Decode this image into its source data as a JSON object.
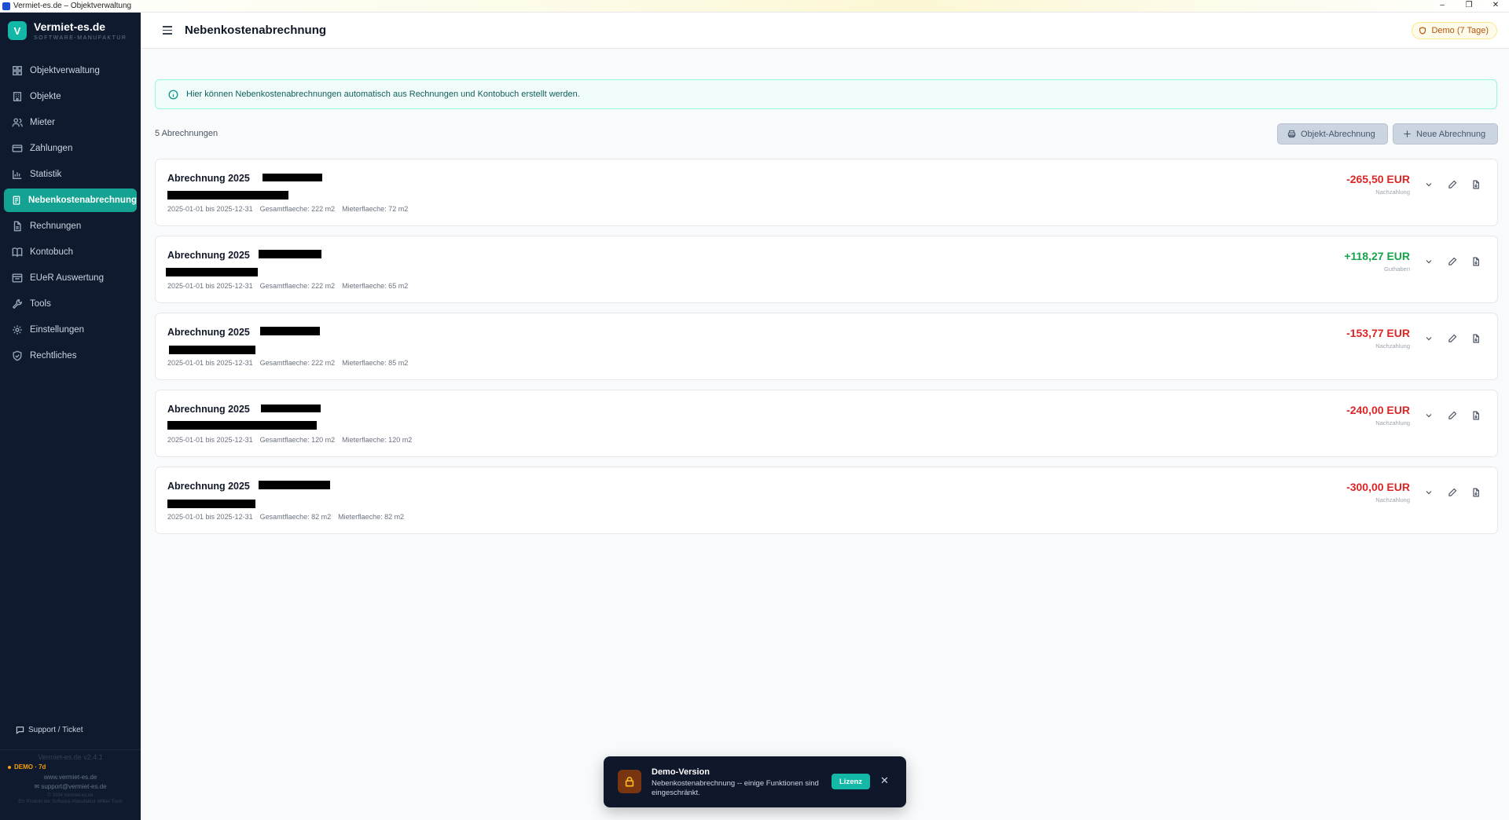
{
  "window": {
    "title": "Vermiet-es.de – Objektverwaltung",
    "controls": [
      "–",
      "❐",
      "✕"
    ]
  },
  "brand": {
    "logo_letter": "V",
    "name": "Vermiet-es.de",
    "tagline": "SOFTWARE-MANUFAKTUR"
  },
  "sidebar": {
    "items": [
      {
        "label": "Objektverwaltung",
        "icon": "grid-icon"
      },
      {
        "label": "Objekte",
        "icon": "building-icon"
      },
      {
        "label": "Mieter",
        "icon": "users-icon"
      },
      {
        "label": "Zahlungen",
        "icon": "credit-card-icon"
      },
      {
        "label": "Statistik",
        "icon": "bar-chart-icon"
      },
      {
        "label": "Nebenkostenabrechnung",
        "icon": "receipt-icon",
        "active": true
      },
      {
        "label": "Rechnungen",
        "icon": "file-icon"
      },
      {
        "label": "Kontobuch",
        "icon": "book-icon"
      },
      {
        "label": "EUeR Auswertung",
        "icon": "report-icon"
      },
      {
        "label": "Tools",
        "icon": "wrench-icon"
      },
      {
        "label": "Einstellungen",
        "icon": "gear-icon"
      },
      {
        "label": "Rechtliches",
        "icon": "shield-icon"
      }
    ],
    "support_label": "Support / Ticket",
    "version": "Vermiet-es.de v2.4.1",
    "demo_tag": "DEMO · 7d",
    "website": "www.vermiet-es.de",
    "email": "support@vermiet-es.de",
    "copyright": "© 2024 Vermiet-es.de",
    "legal": "Ein Produkt der Software-Manufaktur Wilker Tools"
  },
  "header": {
    "title": "Nebenkostenabrechnung",
    "demo_badge": "Demo (7 Tage)"
  },
  "info": {
    "text": "Hier können Nebenkostenabrechnungen automatisch aus Rechnungen und Kontobuch erstellt werden."
  },
  "list": {
    "count_label": "5 Abrechnungen",
    "btn_object": "Objekt-Abrechnung",
    "btn_new": "Neue Abrechnung",
    "cards": [
      {
        "title": "Abrechnung 2025",
        "period": "2025-01-01 bis 2025-12-31",
        "total_area": "Gesamtflaeche: 222 m2",
        "tenant_area": "Mieterflaeche: 72 m2",
        "amount": "-265,50 EUR",
        "amount_type": "Nachzahlung",
        "sign": "neg"
      },
      {
        "title": "Abrechnung 2025",
        "period": "2025-01-01 bis 2025-12-31",
        "total_area": "Gesamtflaeche: 222 m2",
        "tenant_area": "Mieterflaeche: 65 m2",
        "amount": "+118,27 EUR",
        "amount_type": "Guthaben",
        "sign": "pos"
      },
      {
        "title": "Abrechnung 2025",
        "period": "2025-01-01 bis 2025-12-31",
        "total_area": "Gesamtflaeche: 222 m2",
        "tenant_area": "Mieterflaeche: 85 m2",
        "amount": "-153,77 EUR",
        "amount_type": "Nachzahlung",
        "sign": "neg"
      },
      {
        "title": "Abrechnung 2025",
        "period": "2025-01-01 bis 2025-12-31",
        "total_area": "Gesamtflaeche: 120 m2",
        "tenant_area": "Mieterflaeche: 120 m2",
        "amount": "-240,00 EUR",
        "amount_type": "Nachzahlung",
        "sign": "neg"
      },
      {
        "title": "Abrechnung 2025",
        "period": "2025-01-01 bis 2025-12-31",
        "total_area": "Gesamtflaeche: 82 m2",
        "tenant_area": "Mieterflaeche: 82 m2",
        "amount": "-300,00 EUR",
        "amount_type": "Nachzahlung",
        "sign": "neg"
      }
    ]
  },
  "toast": {
    "title": "Demo-Version",
    "text": "Nebenkostenabrechnung -- einige Funktionen sind eingeschränkt.",
    "button": "Lizenz",
    "close": "✕"
  },
  "colors": {
    "sidebar_bg": "#0f1a2e",
    "accent": "#14a392",
    "negative": "#dc2626",
    "positive": "#16a34a",
    "demo": "#b45309"
  }
}
